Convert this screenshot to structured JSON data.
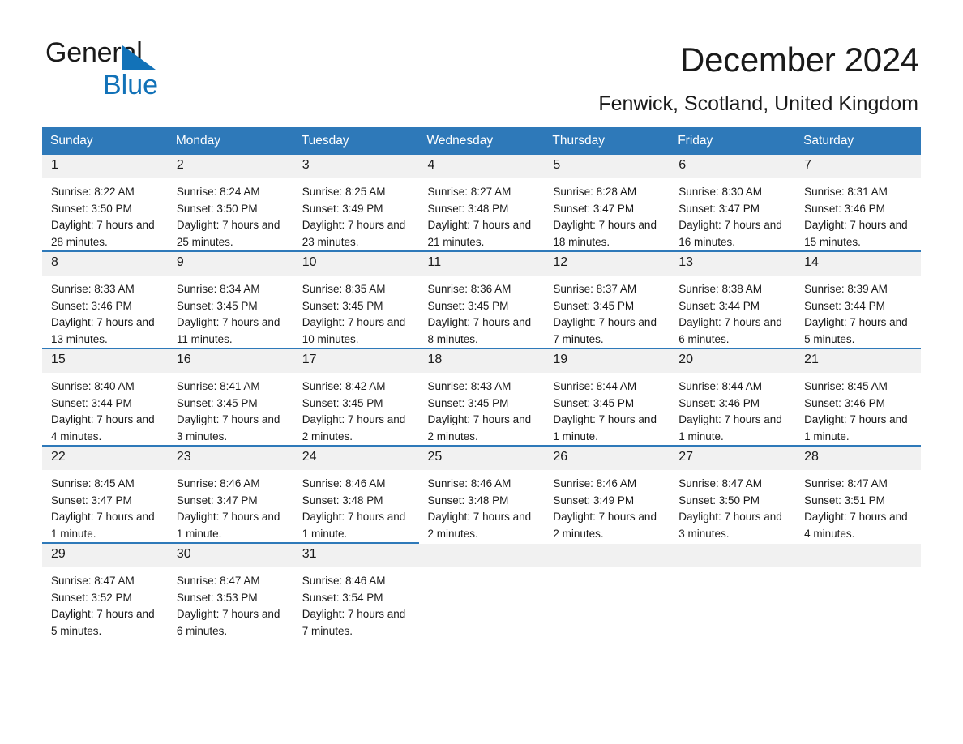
{
  "brand": {
    "name_top": "General",
    "name_bottom": "Blue",
    "accent_color": "#1272b8"
  },
  "header": {
    "title": "December 2024",
    "subtitle": "Fenwick, Scotland, United Kingdom"
  },
  "calendar": {
    "header_bg": "#2e79b9",
    "daynum_bg": "#f1f1f1",
    "weekday_headers": [
      "Sunday",
      "Monday",
      "Tuesday",
      "Wednesday",
      "Thursday",
      "Friday",
      "Saturday"
    ],
    "labels": {
      "sunrise_prefix": "Sunrise:",
      "sunset_prefix": "Sunset:",
      "daylight_prefix": "Daylight:"
    },
    "weeks": [
      [
        {
          "day": "1",
          "sunrise": "Sunrise: 8:22 AM",
          "sunset": "Sunset: 3:50 PM",
          "daylight": "Daylight: 7 hours and 28 minutes."
        },
        {
          "day": "2",
          "sunrise": "Sunrise: 8:24 AM",
          "sunset": "Sunset: 3:50 PM",
          "daylight": "Daylight: 7 hours and 25 minutes."
        },
        {
          "day": "3",
          "sunrise": "Sunrise: 8:25 AM",
          "sunset": "Sunset: 3:49 PM",
          "daylight": "Daylight: 7 hours and 23 minutes."
        },
        {
          "day": "4",
          "sunrise": "Sunrise: 8:27 AM",
          "sunset": "Sunset: 3:48 PM",
          "daylight": "Daylight: 7 hours and 21 minutes."
        },
        {
          "day": "5",
          "sunrise": "Sunrise: 8:28 AM",
          "sunset": "Sunset: 3:47 PM",
          "daylight": "Daylight: 7 hours and 18 minutes."
        },
        {
          "day": "6",
          "sunrise": "Sunrise: 8:30 AM",
          "sunset": "Sunset: 3:47 PM",
          "daylight": "Daylight: 7 hours and 16 minutes."
        },
        {
          "day": "7",
          "sunrise": "Sunrise: 8:31 AM",
          "sunset": "Sunset: 3:46 PM",
          "daylight": "Daylight: 7 hours and 15 minutes."
        }
      ],
      [
        {
          "day": "8",
          "sunrise": "Sunrise: 8:33 AM",
          "sunset": "Sunset: 3:46 PM",
          "daylight": "Daylight: 7 hours and 13 minutes."
        },
        {
          "day": "9",
          "sunrise": "Sunrise: 8:34 AM",
          "sunset": "Sunset: 3:45 PM",
          "daylight": "Daylight: 7 hours and 11 minutes."
        },
        {
          "day": "10",
          "sunrise": "Sunrise: 8:35 AM",
          "sunset": "Sunset: 3:45 PM",
          "daylight": "Daylight: 7 hours and 10 minutes."
        },
        {
          "day": "11",
          "sunrise": "Sunrise: 8:36 AM",
          "sunset": "Sunset: 3:45 PM",
          "daylight": "Daylight: 7 hours and 8 minutes."
        },
        {
          "day": "12",
          "sunrise": "Sunrise: 8:37 AM",
          "sunset": "Sunset: 3:45 PM",
          "daylight": "Daylight: 7 hours and 7 minutes."
        },
        {
          "day": "13",
          "sunrise": "Sunrise: 8:38 AM",
          "sunset": "Sunset: 3:44 PM",
          "daylight": "Daylight: 7 hours and 6 minutes."
        },
        {
          "day": "14",
          "sunrise": "Sunrise: 8:39 AM",
          "sunset": "Sunset: 3:44 PM",
          "daylight": "Daylight: 7 hours and 5 minutes."
        }
      ],
      [
        {
          "day": "15",
          "sunrise": "Sunrise: 8:40 AM",
          "sunset": "Sunset: 3:44 PM",
          "daylight": "Daylight: 7 hours and 4 minutes."
        },
        {
          "day": "16",
          "sunrise": "Sunrise: 8:41 AM",
          "sunset": "Sunset: 3:45 PM",
          "daylight": "Daylight: 7 hours and 3 minutes."
        },
        {
          "day": "17",
          "sunrise": "Sunrise: 8:42 AM",
          "sunset": "Sunset: 3:45 PM",
          "daylight": "Daylight: 7 hours and 2 minutes."
        },
        {
          "day": "18",
          "sunrise": "Sunrise: 8:43 AM",
          "sunset": "Sunset: 3:45 PM",
          "daylight": "Daylight: 7 hours and 2 minutes."
        },
        {
          "day": "19",
          "sunrise": "Sunrise: 8:44 AM",
          "sunset": "Sunset: 3:45 PM",
          "daylight": "Daylight: 7 hours and 1 minute."
        },
        {
          "day": "20",
          "sunrise": "Sunrise: 8:44 AM",
          "sunset": "Sunset: 3:46 PM",
          "daylight": "Daylight: 7 hours and 1 minute."
        },
        {
          "day": "21",
          "sunrise": "Sunrise: 8:45 AM",
          "sunset": "Sunset: 3:46 PM",
          "daylight": "Daylight: 7 hours and 1 minute."
        }
      ],
      [
        {
          "day": "22",
          "sunrise": "Sunrise: 8:45 AM",
          "sunset": "Sunset: 3:47 PM",
          "daylight": "Daylight: 7 hours and 1 minute."
        },
        {
          "day": "23",
          "sunrise": "Sunrise: 8:46 AM",
          "sunset": "Sunset: 3:47 PM",
          "daylight": "Daylight: 7 hours and 1 minute."
        },
        {
          "day": "24",
          "sunrise": "Sunrise: 8:46 AM",
          "sunset": "Sunset: 3:48 PM",
          "daylight": "Daylight: 7 hours and 1 minute."
        },
        {
          "day": "25",
          "sunrise": "Sunrise: 8:46 AM",
          "sunset": "Sunset: 3:48 PM",
          "daylight": "Daylight: 7 hours and 2 minutes."
        },
        {
          "day": "26",
          "sunrise": "Sunrise: 8:46 AM",
          "sunset": "Sunset: 3:49 PM",
          "daylight": "Daylight: 7 hours and 2 minutes."
        },
        {
          "day": "27",
          "sunrise": "Sunrise: 8:47 AM",
          "sunset": "Sunset: 3:50 PM",
          "daylight": "Daylight: 7 hours and 3 minutes."
        },
        {
          "day": "28",
          "sunrise": "Sunrise: 8:47 AM",
          "sunset": "Sunset: 3:51 PM",
          "daylight": "Daylight: 7 hours and 4 minutes."
        }
      ],
      [
        {
          "day": "29",
          "sunrise": "Sunrise: 8:47 AM",
          "sunset": "Sunset: 3:52 PM",
          "daylight": "Daylight: 7 hours and 5 minutes."
        },
        {
          "day": "30",
          "sunrise": "Sunrise: 8:47 AM",
          "sunset": "Sunset: 3:53 PM",
          "daylight": "Daylight: 7 hours and 6 minutes."
        },
        {
          "day": "31",
          "sunrise": "Sunrise: 8:46 AM",
          "sunset": "Sunset: 3:54 PM",
          "daylight": "Daylight: 7 hours and 7 minutes."
        },
        {
          "day": "",
          "sunrise": "",
          "sunset": "",
          "daylight": ""
        },
        {
          "day": "",
          "sunrise": "",
          "sunset": "",
          "daylight": ""
        },
        {
          "day": "",
          "sunrise": "",
          "sunset": "",
          "daylight": ""
        },
        {
          "day": "",
          "sunrise": "",
          "sunset": "",
          "daylight": ""
        }
      ]
    ]
  }
}
